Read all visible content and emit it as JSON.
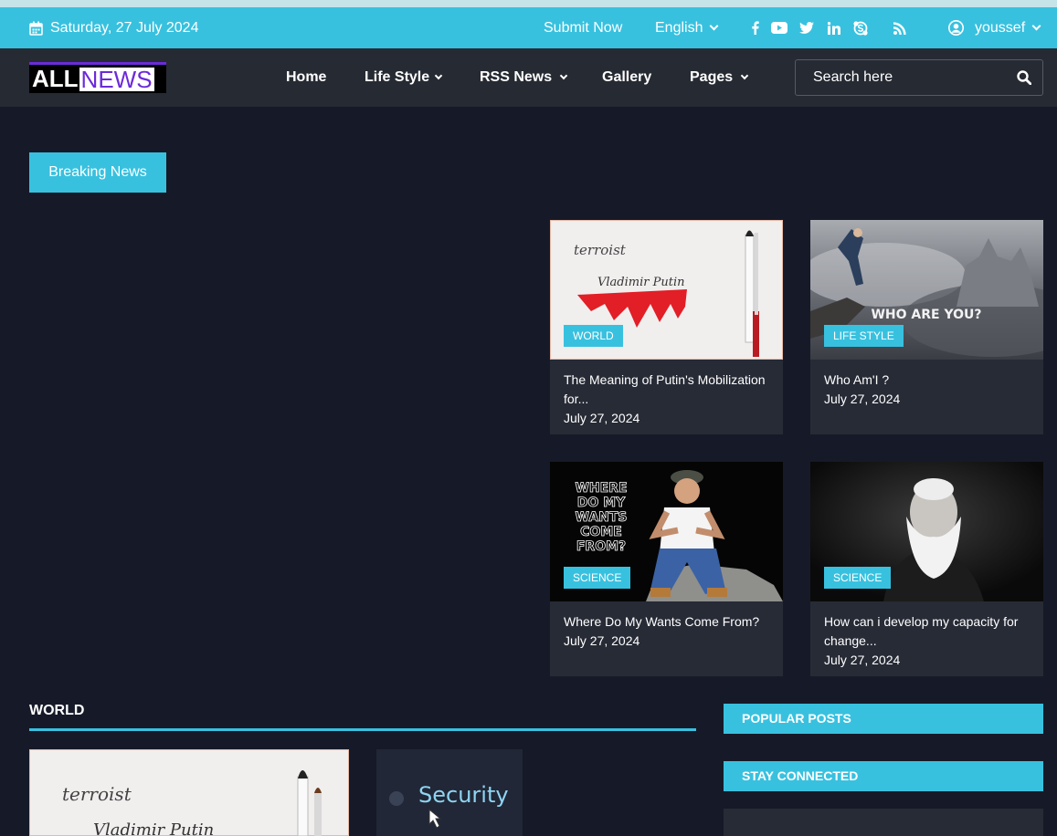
{
  "topbar": {
    "date": "Saturday, 27 July 2024",
    "submit_label": "Submit Now",
    "language": "English",
    "username": "youssef",
    "social": [
      "facebook-icon",
      "youtube-icon",
      "twitter-icon",
      "linkedin-icon",
      "skype-icon",
      "rss-icon"
    ]
  },
  "logo": {
    "part1": "ALL",
    "part2": "NEWS"
  },
  "nav": {
    "items": [
      {
        "label": "Home",
        "dropdown": false
      },
      {
        "label": "Life Style",
        "dropdown": true
      },
      {
        "label": "RSS News",
        "dropdown": true
      },
      {
        "label": "Gallery",
        "dropdown": false
      },
      {
        "label": "Pages",
        "dropdown": true
      }
    ],
    "search_placeholder": "Search here"
  },
  "breaking": {
    "label": "Breaking News"
  },
  "cards": [
    {
      "tag": "WORLD",
      "title": "The Meaning of Putin's Mobilization for...",
      "date": "July 27, 2024"
    },
    {
      "tag": "LIFE STYLE",
      "title": "Who Am'I ?",
      "date": "July 27, 2024"
    },
    {
      "tag": "SCIENCE",
      "title": "Where Do My Wants Come From?",
      "date": "July 27, 2024"
    },
    {
      "tag": "SCIENCE",
      "title": "How can i develop my capacity for change...",
      "date": "July 27, 2024"
    }
  ],
  "image_text": {
    "terroist": "terroist",
    "putin": "Vladimir Putin",
    "who": "WHO ARE YOU?",
    "wants": [
      "WHERE",
      "DO MY",
      "WANTS",
      "COME",
      "FROM?"
    ],
    "security": "Security"
  },
  "world_section": {
    "title": "WORLD"
  },
  "sidebar": {
    "popular": "POPULAR POSTS",
    "connected": "STAY CONNECTED"
  },
  "colors": {
    "accent": "#38c1df",
    "bg": "#161a28",
    "nav": "#262a33",
    "card": "#272b36",
    "logo_purple": "#6c2bd9"
  }
}
